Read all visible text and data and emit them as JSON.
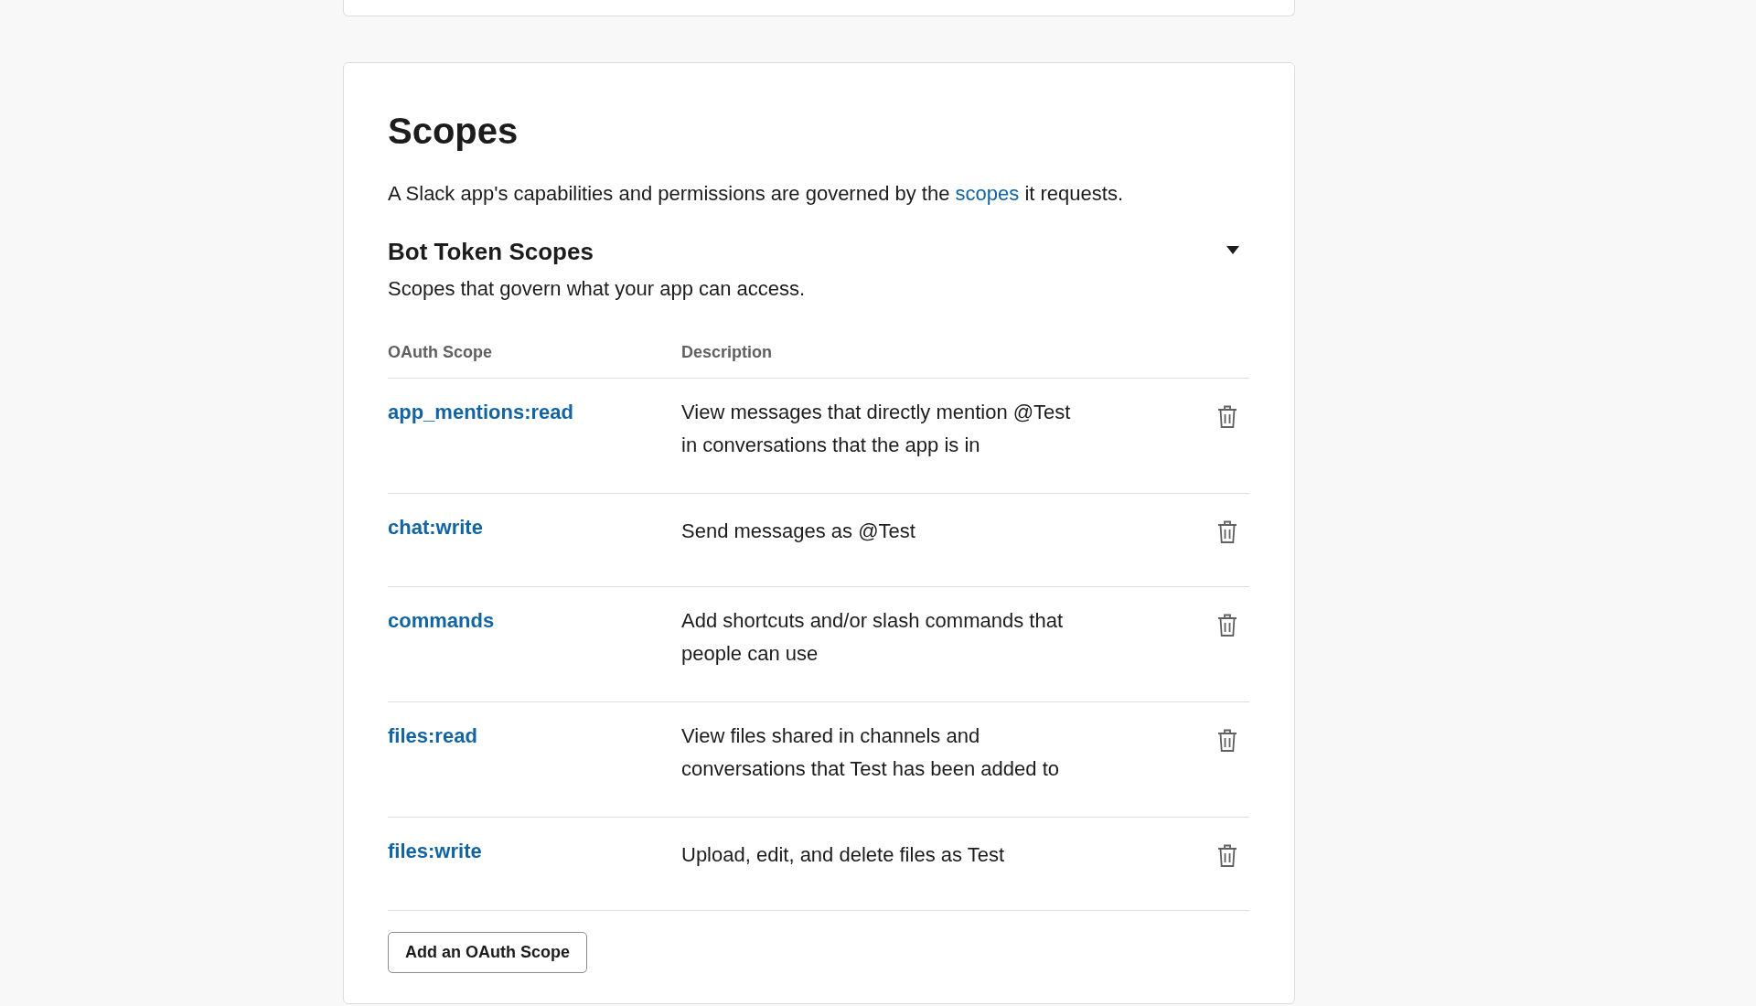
{
  "section": {
    "title": "Scopes",
    "intro_parts": [
      "A Slack app's capabilities and permissions are governed by the ",
      "scopes",
      " it requests."
    ],
    "bot_token_scopes": {
      "title": "Bot Token Scopes",
      "expanded": true,
      "subtitle": "Scopes that govern what your app can access.",
      "columns": [
        "OAuth Scope",
        "Description"
      ],
      "rows": [
        {
          "scope": "app_mentions:read",
          "description": [
            "View messages that directly mention @Test",
            "in conversations that the app is in"
          ]
        },
        {
          "scope": "chat:write",
          "description": [
            "Send messages as @Test"
          ]
        },
        {
          "scope": "commands",
          "description": [
            "Add shortcuts and/or slash commands that",
            "people can use"
          ]
        },
        {
          "scope": "files:read",
          "description": [
            "View files shared in channels and",
            "conversations that Test has been added to"
          ]
        },
        {
          "scope": "files:write",
          "description": [
            "Upload, edit, and delete files as Test"
          ]
        }
      ],
      "add_button": "Add an OAuth Scope"
    }
  }
}
